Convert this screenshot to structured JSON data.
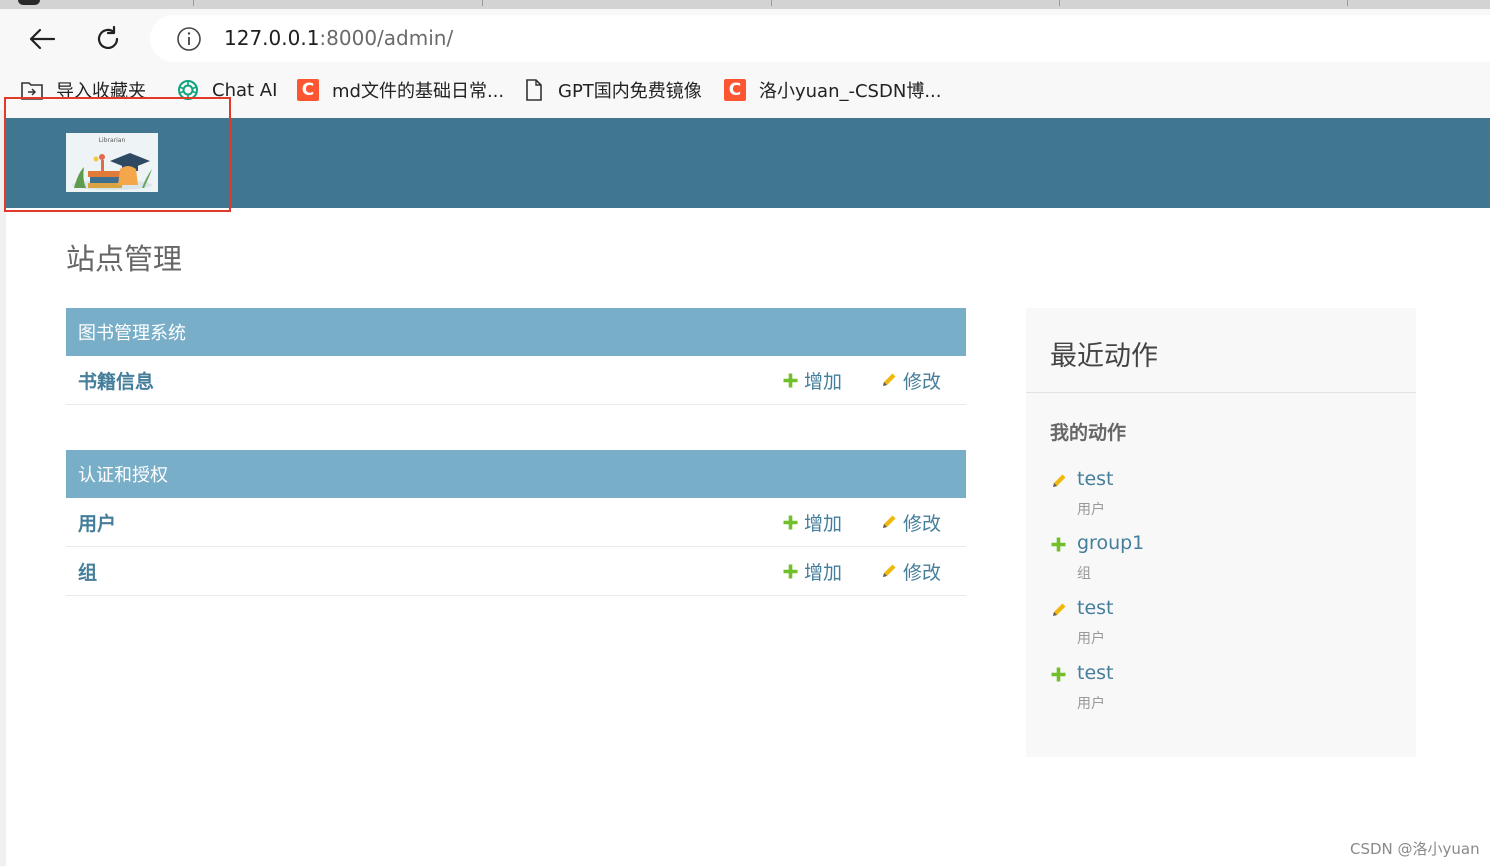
{
  "browser": {
    "url_host": "127.0.0.1",
    "url_rest": ":8000/admin/",
    "bookmarks": [
      {
        "label": "导入收藏夹",
        "icon": "folder-import-icon"
      },
      {
        "label": "Chat AI",
        "icon": "openai-icon"
      },
      {
        "label": "md文件的基础日常...",
        "icon": "csdn-icon"
      },
      {
        "label": "GPT国内免费镜像",
        "icon": "page-icon"
      },
      {
        "label": "洛小yuan_-CSDN博...",
        "icon": "csdn-icon"
      }
    ]
  },
  "header": {
    "logo_text": "Librarian",
    "brand_color": "#417690"
  },
  "main": {
    "title": "站点管理",
    "modules": [
      {
        "caption": "图书管理系统",
        "models": [
          {
            "name": "书籍信息",
            "add": "增加",
            "change": "修改"
          }
        ]
      },
      {
        "caption": "认证和授权",
        "models": [
          {
            "name": "用户",
            "add": "增加",
            "change": "修改"
          },
          {
            "name": "组",
            "add": "增加",
            "change": "修改"
          }
        ]
      }
    ]
  },
  "recent": {
    "title": "最近动作",
    "subtitle": "我的动作",
    "items": [
      {
        "action": "change",
        "icon": "pencil-icon",
        "link": "test",
        "type": "用户"
      },
      {
        "action": "add",
        "icon": "plus-icon",
        "link": "group1",
        "type": "组"
      },
      {
        "action": "change",
        "icon": "pencil-icon",
        "link": "test",
        "type": "用户"
      },
      {
        "action": "add",
        "icon": "plus-icon",
        "link": "test",
        "type": "用户"
      }
    ]
  },
  "watermark": "CSDN @洛小yuan",
  "colors": {
    "caption_bg": "#79aec8",
    "link": "#447e9b",
    "add_green": "#70bf2b",
    "change_yellow": "#efb80b",
    "highlight_red": "#e23a2a"
  }
}
